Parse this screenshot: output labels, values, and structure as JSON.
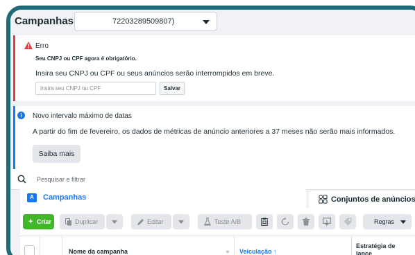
{
  "header": {
    "title": "Campanhas",
    "account_value": "72203289509807)"
  },
  "error_alert": {
    "title": "Erro",
    "bold_text": "Seu CNPJ ou CPF agora é obrigatório.",
    "message": "Insira seu CNPJ ou CPF ou seus anúncios serão interrompidos em breve.",
    "input_placeholder": "Insira seu CNPJ ou CPF",
    "input_value": "",
    "save_label": "Salvar"
  },
  "info_alert": {
    "title": "Novo intervalo máximo de datas",
    "message": "A partir do fim de fevereiro, os dados de métricas de anúncio anteriores a 37 meses não serão mais informados.",
    "button_label": "Saiba mais"
  },
  "search": {
    "placeholder": "Pesquisar e filtrar"
  },
  "tabs": [
    {
      "label": "Campanhas",
      "active": true
    },
    {
      "label": "Conjuntos de anúncios",
      "active": false
    }
  ],
  "toolbar": {
    "create_label": "Criar",
    "duplicate_label": "Duplicar",
    "edit_label": "Editar",
    "ab_test_label": "Teste A/B",
    "rules_label": "Regras"
  },
  "table": {
    "columns": {
      "name": "Nome da campanha",
      "delivery": "Veiculação ↑",
      "strategy": "Estratégia de lance"
    }
  },
  "colors": {
    "frame": "#1f6b78",
    "error": "#e0393e",
    "info": "#1877f2",
    "create": "#42b72a"
  }
}
